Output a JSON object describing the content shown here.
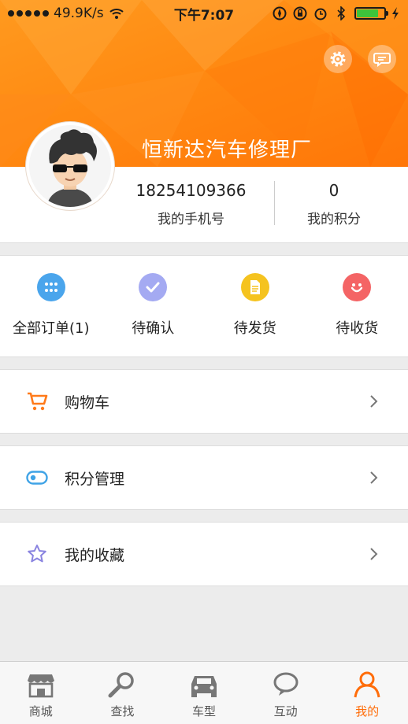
{
  "status_bar": {
    "speed": "49.9K/s",
    "time": "下午7:07",
    "battery_level": 0.8
  },
  "header": {
    "shop_name": "恒新达汽车修理厂",
    "settings_icon": "gear-icon",
    "message_icon": "chat-bubble-icon"
  },
  "profile": {
    "phone": "18254109366",
    "phone_label": "我的手机号",
    "points": "0",
    "points_label": "我的积分"
  },
  "orders": [
    {
      "label": "全部订单(1)",
      "icon": "grid-dots-icon",
      "color": "#4aa5ec"
    },
    {
      "label": "待确认",
      "icon": "checkmark-icon",
      "color": "#a4aaf2"
    },
    {
      "label": "待发货",
      "icon": "document-icon",
      "color": "#f5c31f"
    },
    {
      "label": "待收货",
      "icon": "smile-icon",
      "color": "#f46465"
    }
  ],
  "menu": [
    {
      "label": "购物车",
      "icon": "cart-icon",
      "color": "#ff7a1a"
    },
    {
      "label": "积分管理",
      "icon": "toggle-icon",
      "color": "#3fa3e6"
    },
    {
      "label": "我的收藏",
      "icon": "star-icon",
      "color": "#8a84e0"
    }
  ],
  "tabs": [
    {
      "label": "商城",
      "icon": "shop-icon"
    },
    {
      "label": "查找",
      "icon": "magnifier-icon"
    },
    {
      "label": "车型",
      "icon": "car-icon"
    },
    {
      "label": "互动",
      "icon": "chat-icon"
    },
    {
      "label": "我的",
      "icon": "person-icon",
      "active": true
    }
  ],
  "colors": {
    "accent": "#ff7a12",
    "tab_active": "#ff6d0a"
  }
}
